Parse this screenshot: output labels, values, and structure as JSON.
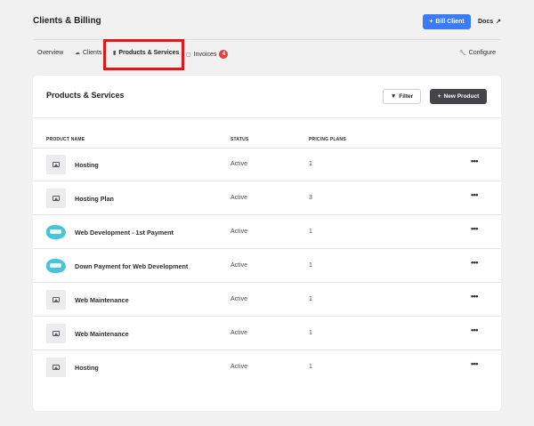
{
  "header": {
    "title": "Clients & Billing",
    "bill_client_label": "Bill Client",
    "docs_label": "Docs"
  },
  "tabs": [
    {
      "label": "Overview"
    },
    {
      "label": "Clients"
    },
    {
      "label": "Products & Services"
    },
    {
      "label": "Invoices",
      "badge": "4"
    }
  ],
  "configure_label": "Configure",
  "card": {
    "title": "Products & Services",
    "filter_label": "Filter",
    "new_product_label": "New Product",
    "columns": [
      "PRODUCT NAME",
      "STATUS",
      "PRICING PLANS"
    ]
  },
  "products": [
    {
      "name": "Hosting",
      "status": "Active",
      "plans": "1",
      "thumb": "image-placeholder-icon"
    },
    {
      "name": "Hosting Plan",
      "status": "Active",
      "plans": "3",
      "thumb": "image-placeholder-icon"
    },
    {
      "name": "Web Development - 1st Payment",
      "status": "Active",
      "plans": "1",
      "thumb": "brand-logo"
    },
    {
      "name": "Down Payment for Web Development",
      "status": "Active",
      "plans": "1",
      "thumb": "brand-logo"
    },
    {
      "name": "Web Maintenance",
      "status": "Active",
      "plans": "1",
      "thumb": "image-placeholder-icon"
    },
    {
      "name": "Web Maintenance",
      "status": "Active",
      "plans": "1",
      "thumb": "image-placeholder-icon"
    },
    {
      "name": "Hosting",
      "status": "Active",
      "plans": "1",
      "thumb": "image-placeholder-icon"
    }
  ],
  "row_action_label": "•••",
  "colors": {
    "primary": "#3b7cf6",
    "dark_button": "#454549",
    "badge": "#e43f3f",
    "highlight": "#e01717"
  }
}
